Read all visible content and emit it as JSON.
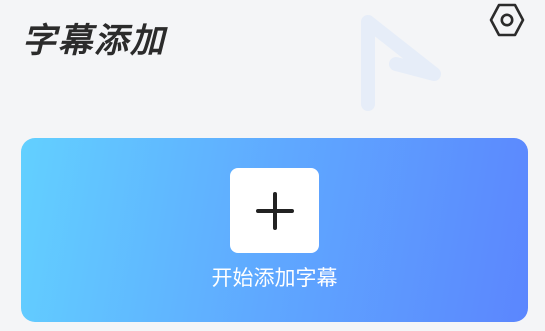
{
  "header": {
    "title": "字幕添加",
    "logo_icon": "play-triangle-watermark-icon",
    "settings_icon": "hexagon-gear-icon"
  },
  "main": {
    "add_subtitle_card": {
      "icon": "plus-icon",
      "label": "开始添加字幕"
    }
  },
  "colors": {
    "background": "#f4f5f7",
    "title_text": "#2b2b2b",
    "card_gradient_start": "#62d0ff",
    "card_gradient_end": "#5b86fe",
    "card_label_text": "#ffffff",
    "plus_box": "#ffffff",
    "plus_glyph": "#222222",
    "watermark": "#e6edf8"
  }
}
